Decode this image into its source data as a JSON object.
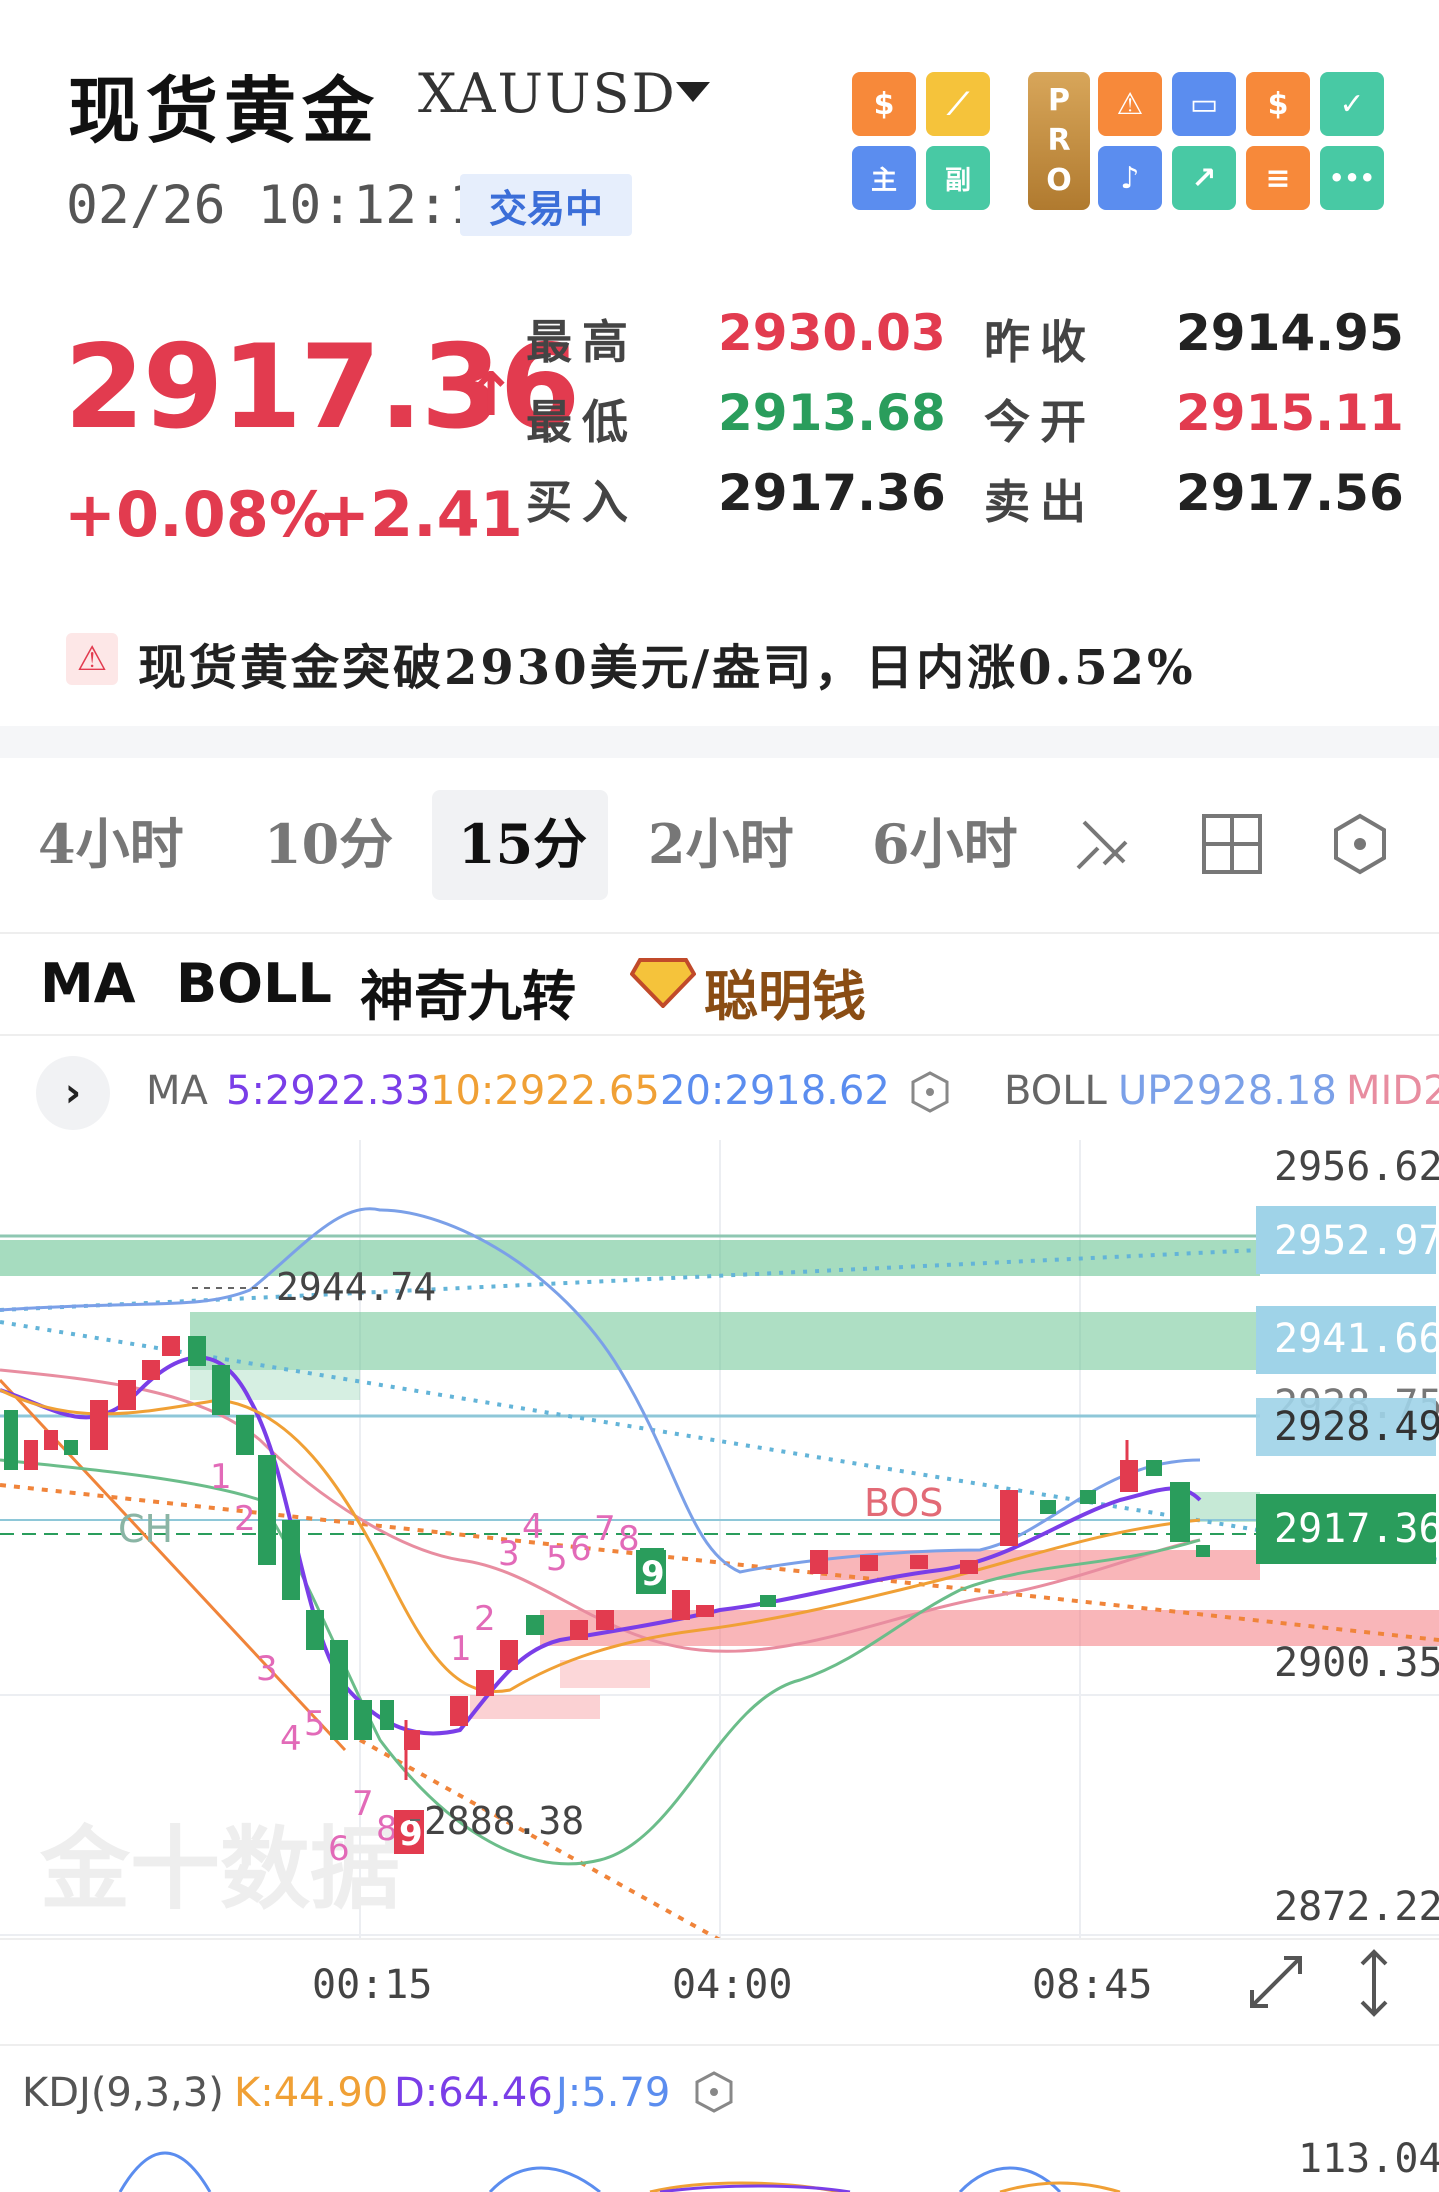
{
  "header": {
    "title": "现货黄金",
    "symbol": "XAUUSD",
    "datetime": "02/26 10:12:10",
    "status": "交易中",
    "tools_left": [
      {
        "icon": "dollar-icon",
        "color": "#f7893a",
        "glyph": "$"
      },
      {
        "icon": "line-draw-icon",
        "color": "#f5c33b",
        "glyph": "⟋"
      },
      {
        "icon": "main-chart-icon",
        "color": "#5b8def",
        "glyph": "主"
      },
      {
        "icon": "sub-chart-icon",
        "color": "#48c9a4",
        "glyph": "副"
      }
    ],
    "pro_label": "PRO",
    "tools_right": [
      {
        "icon": "alarm-icon",
        "color": "#f7893a",
        "glyph": "⚠"
      },
      {
        "icon": "toggle-icon",
        "color": "#5b8def",
        "glyph": "▭"
      },
      {
        "icon": "dollar-coin-icon",
        "color": "#f7893a",
        "glyph": "$"
      },
      {
        "icon": "checklist-icon",
        "color": "#48c9a4",
        "glyph": "✓"
      },
      {
        "icon": "bell-icon",
        "color": "#5b8def",
        "glyph": "♪"
      },
      {
        "icon": "trend-icon",
        "color": "#48c9a4",
        "glyph": "↗"
      },
      {
        "icon": "list-icon",
        "color": "#f7893a",
        "glyph": "≡"
      },
      {
        "icon": "more-icon",
        "color": "#48c9a4",
        "glyph": "•••"
      }
    ]
  },
  "quote": {
    "price": "2917.36",
    "change_pct": "+0.08%",
    "change": "+2.41",
    "stats": [
      {
        "label": "最高",
        "value": "2930.03",
        "color": "#e23b4f",
        "label2": "昨收",
        "value2": "2914.95",
        "color2": "#222222"
      },
      {
        "label": "最低",
        "value": "2913.68",
        "color": "#2a9d5c",
        "label2": "今开",
        "value2": "2915.11",
        "color2": "#e23b4f"
      },
      {
        "label": "买入",
        "value": "2917.36",
        "color": "#222222",
        "label2": "卖出",
        "value2": "2917.56",
        "color2": "#222222"
      }
    ]
  },
  "news": {
    "text": "现货黄金突破2930美元/盎司，日内涨0.52%"
  },
  "periods": [
    "4小时",
    "10分",
    "15分",
    "2小时",
    "6小时"
  ],
  "active_period": "15分",
  "indicators": [
    "MA",
    "BOLL",
    "神奇九转"
  ],
  "smart_money": "聪明钱",
  "ma_line": {
    "label": "MA",
    "ma5": "5:2922.33",
    "ma10": "10:2922.65",
    "ma20": "20:2918.62",
    "boll_label": "BOLL",
    "boll_up": "UP2928.18",
    "boll_mid": "MID2"
  },
  "chart_data": {
    "type": "candlestick",
    "y_ticks": [
      "2956.62",
      "2900.35",
      "2872.22"
    ],
    "level_tags": [
      {
        "value": "2952.97",
        "style": "blue"
      },
      {
        "value": "2941.66",
        "style": "blue"
      },
      {
        "value": "2928.75",
        "style": "plain"
      },
      {
        "value": "2928.49",
        "style": "blue"
      },
      {
        "value": "2917.36",
        "style": "green"
      }
    ],
    "x_ticks": [
      "00:15",
      "04:00",
      "08:45"
    ],
    "annotations": {
      "high": "2944.74",
      "low": "2888.38",
      "bos": "BOS",
      "ch": "CH"
    },
    "watermark": "金十数据",
    "nine_turn_down": [
      "1",
      "2",
      "3",
      "4",
      "5",
      "6",
      "7",
      "8",
      "9"
    ],
    "nine_turn_up": [
      "1",
      "2",
      "3",
      "4",
      "5",
      "6",
      "7",
      "8",
      "9"
    ]
  },
  "kdj": {
    "label": "KDJ(9,3,3)",
    "k": "K:44.90",
    "d": "D:64.46",
    "j": "J:5.79",
    "top_value": "113.04"
  }
}
